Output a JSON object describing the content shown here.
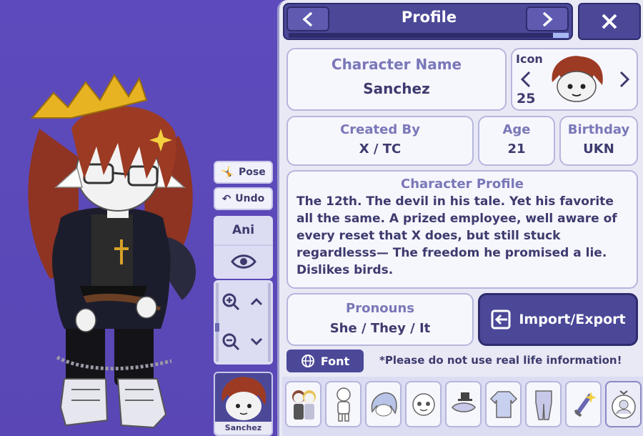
{
  "header": {
    "title": "Profile",
    "prev_icon": "chevron-left-icon",
    "next_icon": "chevron-right-icon",
    "close_icon": "close-icon"
  },
  "character": {
    "name_label": "Character Name",
    "name": "Sanchez",
    "icon_label": "Icon",
    "icon_number": "25",
    "created_by_label": "Created By",
    "created_by": "X / TC",
    "age_label": "Age",
    "age": "21",
    "birthday_label": "Birthday",
    "birthday": "UKN",
    "profile_label": "Character Profile",
    "profile_text": "The 12th. The devil in his tale. Yet his favorite all the same. A prized employee, well aware of every reset that X does, but still stuck regardlesss— The freedom he promised a lie. Dislikes birds.",
    "pronouns_label": "Pronouns",
    "pronouns": "She / They / It"
  },
  "actions": {
    "import_export": "Import/Export",
    "font": "Font",
    "notice": "*Please do not use real life information!"
  },
  "side_controls": {
    "pose": "Pose",
    "undo": "Undo",
    "ani": "Ani",
    "thumb_name": "Sanchez"
  },
  "tray": [
    {
      "icon": "characters-icon"
    },
    {
      "icon": "body-icon"
    },
    {
      "icon": "hair-icon"
    },
    {
      "icon": "face-icon"
    },
    {
      "icon": "accessories-icon"
    },
    {
      "icon": "top-icon"
    },
    {
      "icon": "bottom-icon"
    },
    {
      "icon": "props-icon"
    },
    {
      "icon": "profile-icon"
    }
  ],
  "colors": {
    "background": "#5d4bbd",
    "panel": "#e9e9f6",
    "accent_dark": "#4b4898",
    "label": "#7a78b8",
    "text": "#3d3b6e",
    "hair": "#9c3a24"
  }
}
